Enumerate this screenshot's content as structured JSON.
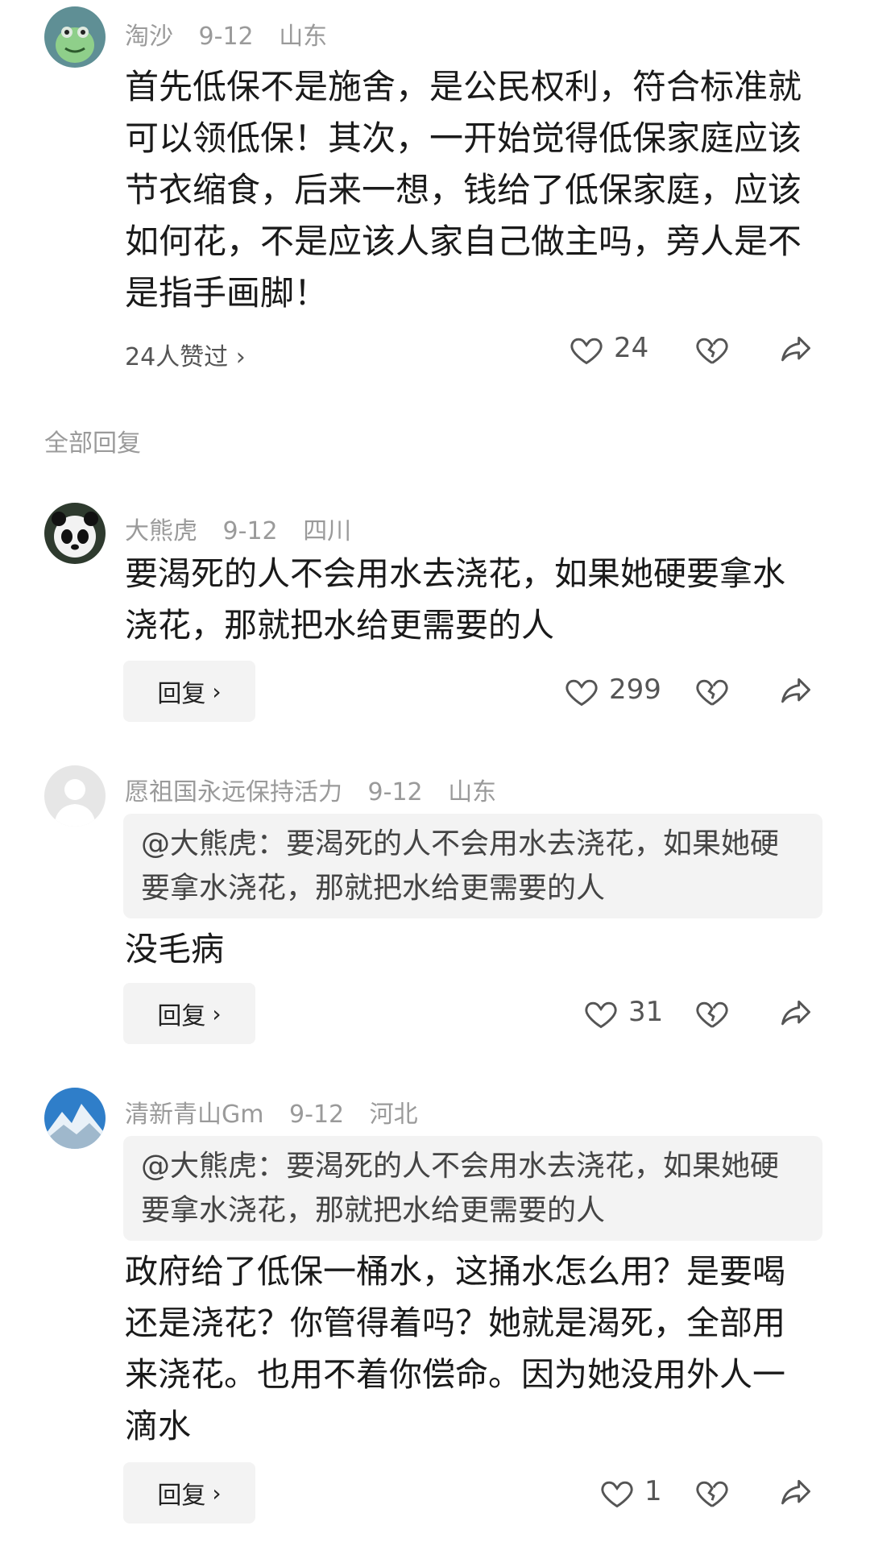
{
  "main_comment": {
    "username": "淘沙",
    "date": "9-12",
    "location": "山东",
    "text": "首先低保不是施舍，是公民权利，符合标准就可以领低保！其次，一开始觉得低保家庭应该节衣缩食，后来一想，钱给了低保家庭，应该如何花，不是应该人家自己做主吗，旁人是不是指手画脚！",
    "likers_text": "24人赞过 ›",
    "likes": "24",
    "avatar_icon": "frog-avatar-icon"
  },
  "replies_header": "全部回复",
  "replies": [
    {
      "username": "大熊虎",
      "date": "9-12",
      "location": "四川",
      "text": "要渴死的人不会用水去浇花，如果她硬要拿水浇花，那就把水给更需要的人",
      "reply_label": "回复",
      "likes": "299",
      "avatar_icon": "panda-avatar-icon"
    },
    {
      "username": "愿祖国永远保持活力",
      "date": "9-12",
      "location": "山东",
      "quote": "@大熊虎：要渴死的人不会用水去浇花，如果她硬要拿水浇花，那就把水给更需要的人",
      "text": "没毛病",
      "reply_label": "回复",
      "likes": "31",
      "avatar_icon": "default-avatar-icon"
    },
    {
      "username": "清新青山Gm",
      "date": "9-12",
      "location": "河北",
      "quote": "@大熊虎：要渴死的人不会用水去浇花，如果她硬要拿水浇花，那就把水给更需要的人",
      "text": "政府给了低保一桶水，这捅水怎么用？是要喝还是浇花？你管得着吗？她就是渴死，全部用来浇花。也用不着你偿命。因为她没用外人一滴水",
      "reply_label": "回复",
      "likes": "1",
      "avatar_icon": "mountain-avatar-icon"
    }
  ],
  "colors": {
    "meta": "#9a9a9a",
    "text": "#1a1a1a",
    "quote_bg": "#f3f3f3"
  }
}
